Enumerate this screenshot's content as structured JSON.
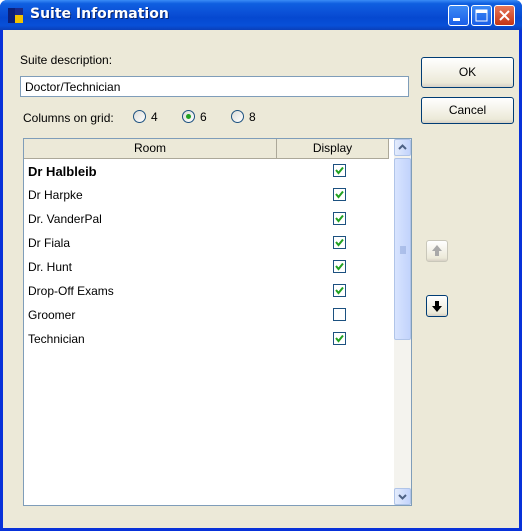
{
  "window": {
    "title": "Suite Information"
  },
  "form": {
    "description_label": "Suite description:",
    "description_value": "Doctor/Technician",
    "columns_label": "Columns on grid:",
    "column_options": [
      "4",
      "6",
      "8"
    ],
    "selected_columns": "6"
  },
  "buttons": {
    "ok": "OK",
    "cancel": "Cancel"
  },
  "grid": {
    "headers": {
      "room": "Room",
      "display": "Display"
    },
    "rows": [
      {
        "room": "Dr Halbleib",
        "display": true,
        "bold": true
      },
      {
        "room": "Dr Harpke",
        "display": true
      },
      {
        "room": "Dr. VanderPal",
        "display": true
      },
      {
        "room": "Dr Fiala",
        "display": true
      },
      {
        "room": "Dr. Hunt",
        "display": true
      },
      {
        "room": "Drop-Off Exams",
        "display": true
      },
      {
        "room": "Groomer",
        "display": false
      },
      {
        "room": "Technician",
        "display": true
      }
    ]
  },
  "colors": {
    "titlebar": "#0a4fd6",
    "dialog_bg": "#ece9d8",
    "check": "#21a121"
  },
  "icons": [
    "app-icon",
    "minimize-icon",
    "maximize-icon",
    "close-icon",
    "arrow-up-icon",
    "arrow-down-icon",
    "check-icon"
  ]
}
